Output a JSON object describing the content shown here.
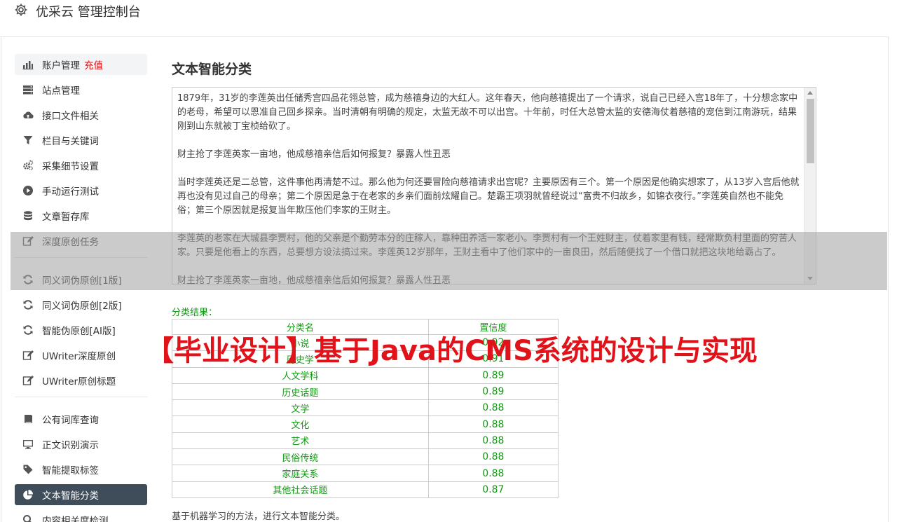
{
  "header": {
    "title": "优采云 管理控制台",
    "icon": "gear-icon"
  },
  "sidebar": {
    "items": [
      {
        "label": "账户管理",
        "extra": "充值",
        "icon": "bar-chart-icon"
      },
      {
        "label": "站点管理",
        "icon": "server-icon"
      },
      {
        "label": "接口文件相关",
        "icon": "cloud-upload-icon"
      },
      {
        "label": "栏目与关键词",
        "icon": "filter-icon"
      },
      {
        "label": "采集细节设置",
        "icon": "cogs-icon"
      },
      {
        "label": "手动运行测试",
        "icon": "play-circle-icon"
      },
      {
        "label": "文章暂存库",
        "icon": "database-icon"
      },
      {
        "label": "深度原创任务",
        "icon": "edit-icon"
      },
      {
        "label": "同义词伪原创[1版]",
        "icon": "refresh-icon"
      },
      {
        "label": "同义词伪原创[2版]",
        "icon": "refresh-icon"
      },
      {
        "label": "智能伪原创[AI版]",
        "icon": "refresh-icon"
      },
      {
        "label": "UWriter深度原创",
        "icon": "edit-icon"
      },
      {
        "label": "UWriter原创标题",
        "icon": "edit-icon"
      },
      {
        "label": "公有词库查询",
        "icon": "book-icon"
      },
      {
        "label": "正文识别演示",
        "icon": "desktop-icon"
      },
      {
        "label": "智能提取标签",
        "icon": "tag-icon"
      },
      {
        "label": "文本智能分类",
        "icon": "pie-chart-icon"
      },
      {
        "label": "内容相关度检测",
        "icon": "search-icon"
      }
    ]
  },
  "main": {
    "title": "文本智能分类",
    "text_paragraphs": [
      "1879年，31岁的李莲英出任储秀宫四品花翎总管，成为慈禧身边的大红人。这年春天，他向慈禧提出了一个请求，说自己已经入宫18年了，十分想念家中的老母，希望可以恩准自己回乡探亲。当时清朝有明确的规定，太监无故不可以出宫。十年前，时任大总管太监的安德海仗着慈禧的宠信到江南游玩，结果刚到山东就被丁宝桢给砍了。",
      "财主抢了李莲英家一亩地，他成慈禧亲信后如何报复？暴露人性丑恶",
      "当时李莲英还是二总管，这件事他再清楚不过。那么他为何还要冒险向慈禧请求出宫呢？主要原因有三个。第一个原因是他确实想家了，从13岁入宫后他就再也没有见过自己的母亲；第二个原因是急于在老家的乡亲们面前炫耀自己。楚霸王项羽就曾经说过“富贵不归故乡，如锦衣夜行。”李莲英自然也不能免俗；第三个原因就是报复当年欺压他们李家的王财主。",
      "李莲英的老家在大城县李贾村，他的父亲是个勤劳本分的庄稼人，靠种田养活一家老小。李贾村有一个王姓财主，仗着家里有钱，经常欺负村里面的穷苦人家。只要是他看上的东西，总要想方设法搞过来。李莲英12岁那年，王财主看中了他们家中的一亩良田，然后随便找了一个借口就把这块地给霸占了。",
      "财主抢了李莲英家一亩地，他成慈禧亲信后如何报复？暴露人性丑恶"
    ],
    "result_label": "分类结果：",
    "table_headers": [
      "分类名",
      "置信度"
    ],
    "table_rows": [
      [
        "小说",
        "0.92"
      ],
      [
        "历史学",
        "0.91"
      ],
      [
        "人文学科",
        "0.89"
      ],
      [
        "历史话题",
        "0.89"
      ],
      [
        "文学",
        "0.88"
      ],
      [
        "文化",
        "0.88"
      ],
      [
        "艺术",
        "0.88"
      ],
      [
        "民俗传统",
        "0.88"
      ],
      [
        "家庭关系",
        "0.88"
      ],
      [
        "其他社会话题",
        "0.87"
      ]
    ],
    "footnote": "基于机器学习的方法，进行文本智能分类。"
  },
  "watermark": "【毕业设计】基于Java的CMS系统的设计与实现",
  "colors": {
    "active_bg": "#3f4d5a",
    "result_green": "#129912",
    "accent_red": "#d11",
    "watermark_red": "#e0121a"
  }
}
